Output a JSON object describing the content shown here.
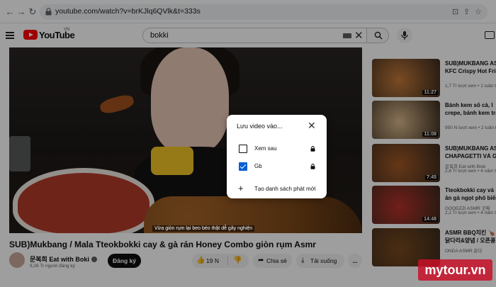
{
  "browser": {
    "url": "youtube.com/watch?v=brKJlq6QVlk&t=333s"
  },
  "header": {
    "logo_text": "YouTube",
    "region": "VN",
    "search_query": "bokki"
  },
  "video": {
    "caption": "Vừa giòn rụm lại beo béo thật dễ gây nghiện",
    "title": "SUB)Mukbang / Mala Tteokbokki cay & gà rán Honey Combo giòn rụm Asmr",
    "channel": "문복희 Eat with Boki",
    "subscribers": "9,26 Tr người đăng ký",
    "subscribe_label": "Đăng ký",
    "likes": "19 N",
    "share_label": "Chia sẻ",
    "download_label": "Tải xuống",
    "more_label": "..."
  },
  "sidebar": {
    "items": [
      {
        "title1": "SUB)MUKBANG ASM",
        "title2": "KFC Crispy Hot Frie",
        "channel": "",
        "meta": "1,7 Tr lượt xem  •  1 tuần trướ",
        "duration": "11:27",
        "color": "#c47a3a"
      },
      {
        "title1": "Bánh kem số cà, l",
        "title2": "crepe, bánh kem trá",
        "channel": "",
        "meta": "950 N lượt xem  •  2 tuần trư",
        "duration": "11:08",
        "color": "#d9b98b"
      },
      {
        "title1": "SUB)MUKBANG ASM",
        "title2": "CHAPAGETTI VÀ GÀ",
        "channel": "문복희 Eat with Boki",
        "meta": "2,8 Tr lượt xem  •  4 năm trư",
        "duration": "7:45",
        "color": "#a35a26"
      },
      {
        "title1": "Tteokbokki cay và",
        "title2": "ăn gà ngọt phô biến",
        "channel": "GOODZZI ASMR 굿찌",
        "meta": "2,2 Tr lượt xem  •  4 năm trư",
        "duration": "14:48",
        "color": "#b8322a"
      },
      {
        "title1": "ASMR BBQ치킨 🍗",
        "title2": "닭다리&양념 / 오픈콩",
        "channel": "ONDA ASMR 온다",
        "meta": "",
        "duration": "",
        "color": "#7a4a1e"
      }
    ]
  },
  "dialog": {
    "title": "Lưu video vào...",
    "options": [
      {
        "label": "Xem sau",
        "checked": false
      },
      {
        "label": "Gb",
        "checked": true
      }
    ],
    "new_playlist_label": "Tạo danh sách phát mới"
  },
  "watermark": "mytour.vn"
}
